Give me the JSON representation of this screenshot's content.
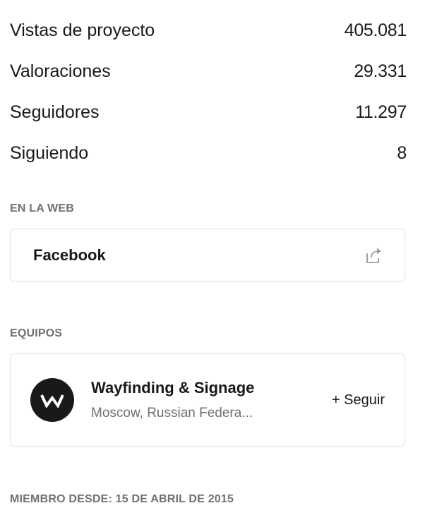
{
  "stats": [
    {
      "label": "Vistas de proyecto",
      "value": "405.081"
    },
    {
      "label": "Valoraciones",
      "value": "29.331"
    },
    {
      "label": "Seguidores",
      "value": "11.297"
    },
    {
      "label": "Siguiendo",
      "value": "8"
    }
  ],
  "web": {
    "title": "EN LA WEB",
    "links": [
      {
        "label": "Facebook",
        "icon": "external-link-icon"
      }
    ]
  },
  "teams": {
    "title": "EQUIPOS",
    "items": [
      {
        "name": "Wayfinding & Signage",
        "location": "Moscow, Russian Federa...",
        "avatar_icon": "team-logo-w-icon",
        "follow_label": "+ Seguir"
      }
    ]
  },
  "member_since": "MIEMBRO DESDE: 15 DE ABRIL DE 2015",
  "colors": {
    "text": "#191919",
    "muted": "#707070",
    "border": "#e2e2e2",
    "avatar_bg": "#191919"
  }
}
